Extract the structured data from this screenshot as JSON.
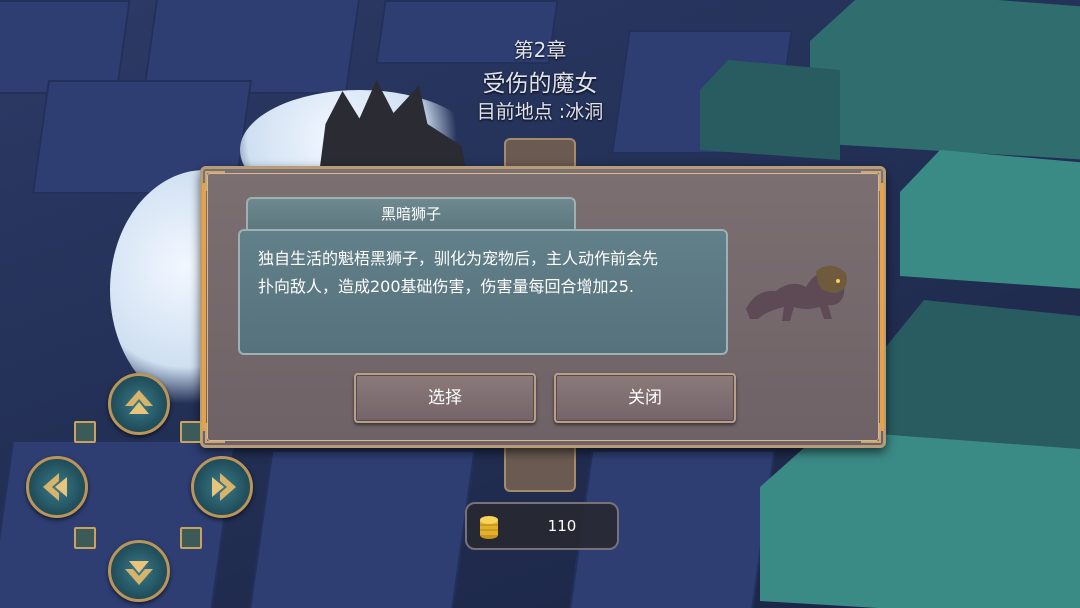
{
  "chapter": {
    "number": "第2章",
    "title": "受伤的魔女",
    "location": "目前地点 :冰洞"
  },
  "dialog": {
    "pet_name": "黑暗狮子",
    "description": "独自生活的魁梧黑狮子，驯化为宠物后，主人动作前会先\n扑向敌人，造成200基础伤害，伤害量每回合增加25.",
    "select_label": "选择",
    "close_label": "关闭"
  },
  "hud": {
    "coins": "110",
    "coin_icon": "gold-coin-stack-icon"
  },
  "controls": {
    "up_icon": "arrow-up-icon",
    "down_icon": "arrow-down-icon",
    "left_icon": "arrow-left-icon",
    "right_icon": "arrow-right-icon"
  },
  "colors": {
    "dialog_border": "#b79c78",
    "dialog_accent": "#e6a24a",
    "desc_box": "#5f7d86",
    "dpad_ring": "#b9955a"
  }
}
